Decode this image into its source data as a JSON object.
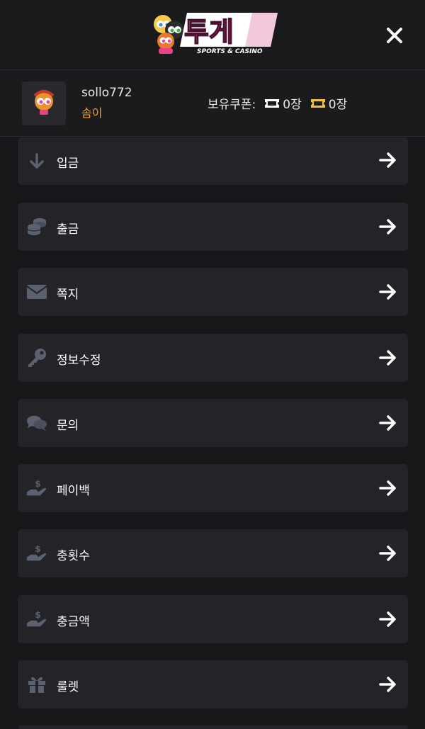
{
  "header": {
    "logo_text": "투게",
    "logo_subtext": "SPORTS & CASINO",
    "close_icon": "close-icon"
  },
  "user": {
    "username": "sollo772",
    "level": "솜이",
    "coupon_label": "보유쿠폰:",
    "coupon_white_count": "0장",
    "coupon_yellow_count": "0장"
  },
  "colors": {
    "background": "#17171a",
    "card": "#232328",
    "icon": "#5b6170",
    "accent_orange": "#f0a22e",
    "coupon_yellow": "#f2c230"
  },
  "menu": [
    {
      "label": "입금",
      "icon": "arrow-down-icon"
    },
    {
      "label": "출금",
      "icon": "coins-icon"
    },
    {
      "label": "쪽지",
      "icon": "envelope-icon"
    },
    {
      "label": "정보수정",
      "icon": "key-icon"
    },
    {
      "label": "문의",
      "icon": "chat-icon"
    },
    {
      "label": "페이백",
      "icon": "hand-dollar-icon"
    },
    {
      "label": "충횟수",
      "icon": "hand-dollar-icon"
    },
    {
      "label": "충금액",
      "icon": "hand-dollar-icon"
    },
    {
      "label": "룰렛",
      "icon": "gift-icon"
    }
  ]
}
